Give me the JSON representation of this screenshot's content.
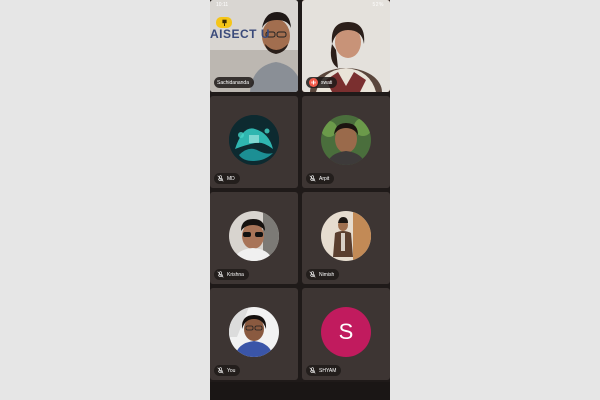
{
  "status_bar": {
    "time": "10:11",
    "battery": "52%"
  },
  "tiles": [
    {
      "name": "Sachidananda",
      "banner_text": "AISECT U",
      "state": "video"
    },
    {
      "name": "swati",
      "state": "video-speaking"
    },
    {
      "name": "MD",
      "muted": true
    },
    {
      "name": "Arpit",
      "muted": true
    },
    {
      "name": "Krishna",
      "muted": true
    },
    {
      "name": "Nimish",
      "muted": true
    },
    {
      "name": "You",
      "muted": true
    },
    {
      "name": "SHYAM",
      "muted": true,
      "avatar_letter": "S"
    }
  ],
  "colors": {
    "accent": "#f5c518",
    "speaking": "#f05a4a",
    "letter_avatar": "#c11b5e"
  }
}
